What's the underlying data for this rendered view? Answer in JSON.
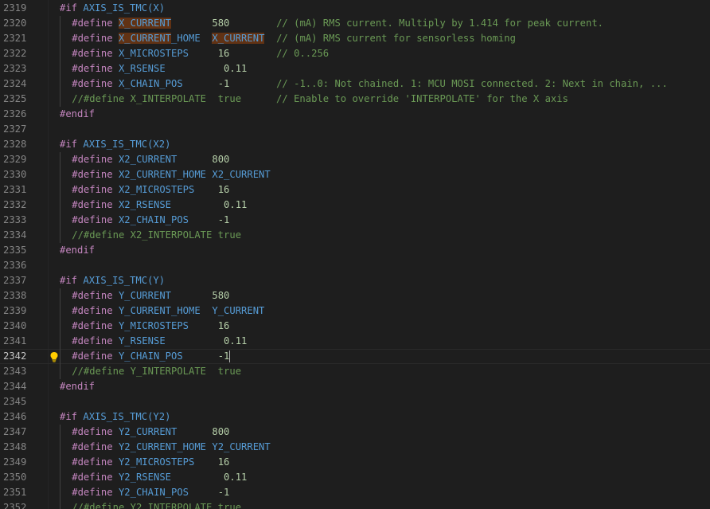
{
  "editor": {
    "active_line": 2342,
    "lines": [
      {
        "num": "2319",
        "indent": 0,
        "tokens": [
          {
            "t": "#if ",
            "c": "kw"
          },
          {
            "t": "AXIS_IS_TMC(X)",
            "c": "macro"
          }
        ]
      },
      {
        "num": "2320",
        "indent": 1,
        "tokens": [
          {
            "t": "#define ",
            "c": "kw"
          },
          {
            "t": "X_CURRENT",
            "c": "def hl"
          },
          {
            "t": "       ",
            "c": ""
          },
          {
            "t": "580",
            "c": "num"
          },
          {
            "t": "        ",
            "c": ""
          },
          {
            "t": "// (mA) RMS current. Multiply by 1.414 for peak current.",
            "c": "cmt"
          }
        ]
      },
      {
        "num": "2321",
        "indent": 1,
        "tokens": [
          {
            "t": "#define ",
            "c": "kw"
          },
          {
            "t": "X_CURRENT",
            "c": "def hl"
          },
          {
            "t": "_HOME  ",
            "c": "def"
          },
          {
            "t": "X_CURRENT",
            "c": "def hl"
          },
          {
            "t": "  ",
            "c": ""
          },
          {
            "t": "// (mA) RMS current for sensorless homing",
            "c": "cmt"
          }
        ]
      },
      {
        "num": "2322",
        "indent": 1,
        "tokens": [
          {
            "t": "#define ",
            "c": "kw"
          },
          {
            "t": "X_MICROSTEPS",
            "c": "def"
          },
          {
            "t": "     ",
            "c": ""
          },
          {
            "t": "16",
            "c": "num"
          },
          {
            "t": "        ",
            "c": ""
          },
          {
            "t": "// 0..256",
            "c": "cmt"
          }
        ]
      },
      {
        "num": "2323",
        "indent": 1,
        "tokens": [
          {
            "t": "#define ",
            "c": "kw"
          },
          {
            "t": "X_RSENSE",
            "c": "def"
          },
          {
            "t": "          ",
            "c": ""
          },
          {
            "t": "0.11",
            "c": "num"
          }
        ]
      },
      {
        "num": "2324",
        "indent": 1,
        "tokens": [
          {
            "t": "#define ",
            "c": "kw"
          },
          {
            "t": "X_CHAIN_POS",
            "c": "def"
          },
          {
            "t": "      ",
            "c": ""
          },
          {
            "t": "-1",
            "c": "num"
          },
          {
            "t": "        ",
            "c": ""
          },
          {
            "t": "// -1..0: Not chained. 1: MCU MOSI connected. 2: Next in chain, ...",
            "c": "cmt"
          }
        ]
      },
      {
        "num": "2325",
        "indent": 1,
        "tokens": [
          {
            "t": "//#define X_INTERPOLATE  true      // Enable to override 'INTERPOLATE' for the X axis",
            "c": "cmt"
          }
        ]
      },
      {
        "num": "2326",
        "indent": 0,
        "tokens": [
          {
            "t": "#endif",
            "c": "kw"
          }
        ]
      },
      {
        "num": "2327",
        "indent": 0,
        "tokens": []
      },
      {
        "num": "2328",
        "indent": 0,
        "tokens": [
          {
            "t": "#if ",
            "c": "kw"
          },
          {
            "t": "AXIS_IS_TMC(X2)",
            "c": "macro"
          }
        ]
      },
      {
        "num": "2329",
        "indent": 1,
        "tokens": [
          {
            "t": "#define ",
            "c": "kw"
          },
          {
            "t": "X2_CURRENT",
            "c": "def"
          },
          {
            "t": "      ",
            "c": ""
          },
          {
            "t": "800",
            "c": "num"
          }
        ]
      },
      {
        "num": "2330",
        "indent": 1,
        "tokens": [
          {
            "t": "#define ",
            "c": "kw"
          },
          {
            "t": "X2_CURRENT_HOME X2_CURRENT",
            "c": "def"
          }
        ]
      },
      {
        "num": "2331",
        "indent": 1,
        "tokens": [
          {
            "t": "#define ",
            "c": "kw"
          },
          {
            "t": "X2_MICROSTEPS",
            "c": "def"
          },
          {
            "t": "    ",
            "c": ""
          },
          {
            "t": "16",
            "c": "num"
          }
        ]
      },
      {
        "num": "2332",
        "indent": 1,
        "tokens": [
          {
            "t": "#define ",
            "c": "kw"
          },
          {
            "t": "X2_RSENSE",
            "c": "def"
          },
          {
            "t": "         ",
            "c": ""
          },
          {
            "t": "0.11",
            "c": "num"
          }
        ]
      },
      {
        "num": "2333",
        "indent": 1,
        "tokens": [
          {
            "t": "#define ",
            "c": "kw"
          },
          {
            "t": "X2_CHAIN_POS",
            "c": "def"
          },
          {
            "t": "     ",
            "c": ""
          },
          {
            "t": "-1",
            "c": "num"
          }
        ]
      },
      {
        "num": "2334",
        "indent": 1,
        "tokens": [
          {
            "t": "//#define X2_INTERPOLATE true",
            "c": "cmt"
          }
        ]
      },
      {
        "num": "2335",
        "indent": 0,
        "tokens": [
          {
            "t": "#endif",
            "c": "kw"
          }
        ]
      },
      {
        "num": "2336",
        "indent": 0,
        "tokens": []
      },
      {
        "num": "2337",
        "indent": 0,
        "tokens": [
          {
            "t": "#if ",
            "c": "kw"
          },
          {
            "t": "AXIS_IS_TMC(Y)",
            "c": "macro"
          }
        ]
      },
      {
        "num": "2338",
        "indent": 1,
        "tokens": [
          {
            "t": "#define ",
            "c": "kw"
          },
          {
            "t": "Y_CURRENT",
            "c": "def"
          },
          {
            "t": "       ",
            "c": ""
          },
          {
            "t": "580",
            "c": "num"
          }
        ]
      },
      {
        "num": "2339",
        "indent": 1,
        "tokens": [
          {
            "t": "#define ",
            "c": "kw"
          },
          {
            "t": "Y_CURRENT_HOME  Y_CURRENT",
            "c": "def"
          }
        ]
      },
      {
        "num": "2340",
        "indent": 1,
        "tokens": [
          {
            "t": "#define ",
            "c": "kw"
          },
          {
            "t": "Y_MICROSTEPS",
            "c": "def"
          },
          {
            "t": "     ",
            "c": ""
          },
          {
            "t": "16",
            "c": "num"
          }
        ]
      },
      {
        "num": "2341",
        "indent": 1,
        "tokens": [
          {
            "t": "#define ",
            "c": "kw"
          },
          {
            "t": "Y_RSENSE",
            "c": "def"
          },
          {
            "t": "          ",
            "c": ""
          },
          {
            "t": "0.11",
            "c": "num"
          }
        ]
      },
      {
        "num": "2342",
        "indent": 1,
        "tokens": [
          {
            "t": "#define ",
            "c": "kw"
          },
          {
            "t": "Y_CHAIN_POS",
            "c": "def"
          },
          {
            "t": "      ",
            "c": ""
          },
          {
            "t": "-1",
            "c": "num"
          }
        ],
        "cursor": true,
        "bulb": true
      },
      {
        "num": "2343",
        "indent": 1,
        "tokens": [
          {
            "t": "//#define Y_INTERPOLATE  true",
            "c": "cmt"
          }
        ]
      },
      {
        "num": "2344",
        "indent": 0,
        "tokens": [
          {
            "t": "#endif",
            "c": "kw"
          }
        ]
      },
      {
        "num": "2345",
        "indent": 0,
        "tokens": []
      },
      {
        "num": "2346",
        "indent": 0,
        "tokens": [
          {
            "t": "#if ",
            "c": "kw"
          },
          {
            "t": "AXIS_IS_TMC(Y2)",
            "c": "macro"
          }
        ]
      },
      {
        "num": "2347",
        "indent": 1,
        "tokens": [
          {
            "t": "#define ",
            "c": "kw"
          },
          {
            "t": "Y2_CURRENT",
            "c": "def"
          },
          {
            "t": "      ",
            "c": ""
          },
          {
            "t": "800",
            "c": "num"
          }
        ]
      },
      {
        "num": "2348",
        "indent": 1,
        "tokens": [
          {
            "t": "#define ",
            "c": "kw"
          },
          {
            "t": "Y2_CURRENT_HOME Y2_CURRENT",
            "c": "def"
          }
        ]
      },
      {
        "num": "2349",
        "indent": 1,
        "tokens": [
          {
            "t": "#define ",
            "c": "kw"
          },
          {
            "t": "Y2_MICROSTEPS",
            "c": "def"
          },
          {
            "t": "    ",
            "c": ""
          },
          {
            "t": "16",
            "c": "num"
          }
        ]
      },
      {
        "num": "2350",
        "indent": 1,
        "tokens": [
          {
            "t": "#define ",
            "c": "kw"
          },
          {
            "t": "Y2_RSENSE",
            "c": "def"
          },
          {
            "t": "         ",
            "c": ""
          },
          {
            "t": "0.11",
            "c": "num"
          }
        ]
      },
      {
        "num": "2351",
        "indent": 1,
        "tokens": [
          {
            "t": "#define ",
            "c": "kw"
          },
          {
            "t": "Y2_CHAIN_POS",
            "c": "def"
          },
          {
            "t": "     ",
            "c": ""
          },
          {
            "t": "-1",
            "c": "num"
          }
        ]
      },
      {
        "num": "2352",
        "indent": 1,
        "tokens": [
          {
            "t": "//#define Y2_INTERPOLATE true",
            "c": "cmt"
          }
        ]
      }
    ],
    "icons": {
      "lightbulb": "lightbulb-icon"
    },
    "colors": {
      "background": "#1e1e1e",
      "keyword": "#c586c0",
      "macro": "#569cd6",
      "number": "#b5cea8",
      "comment": "#6a9955",
      "highlight": "#613214",
      "line_number": "#858585",
      "bulb": "#ffcc00"
    }
  }
}
